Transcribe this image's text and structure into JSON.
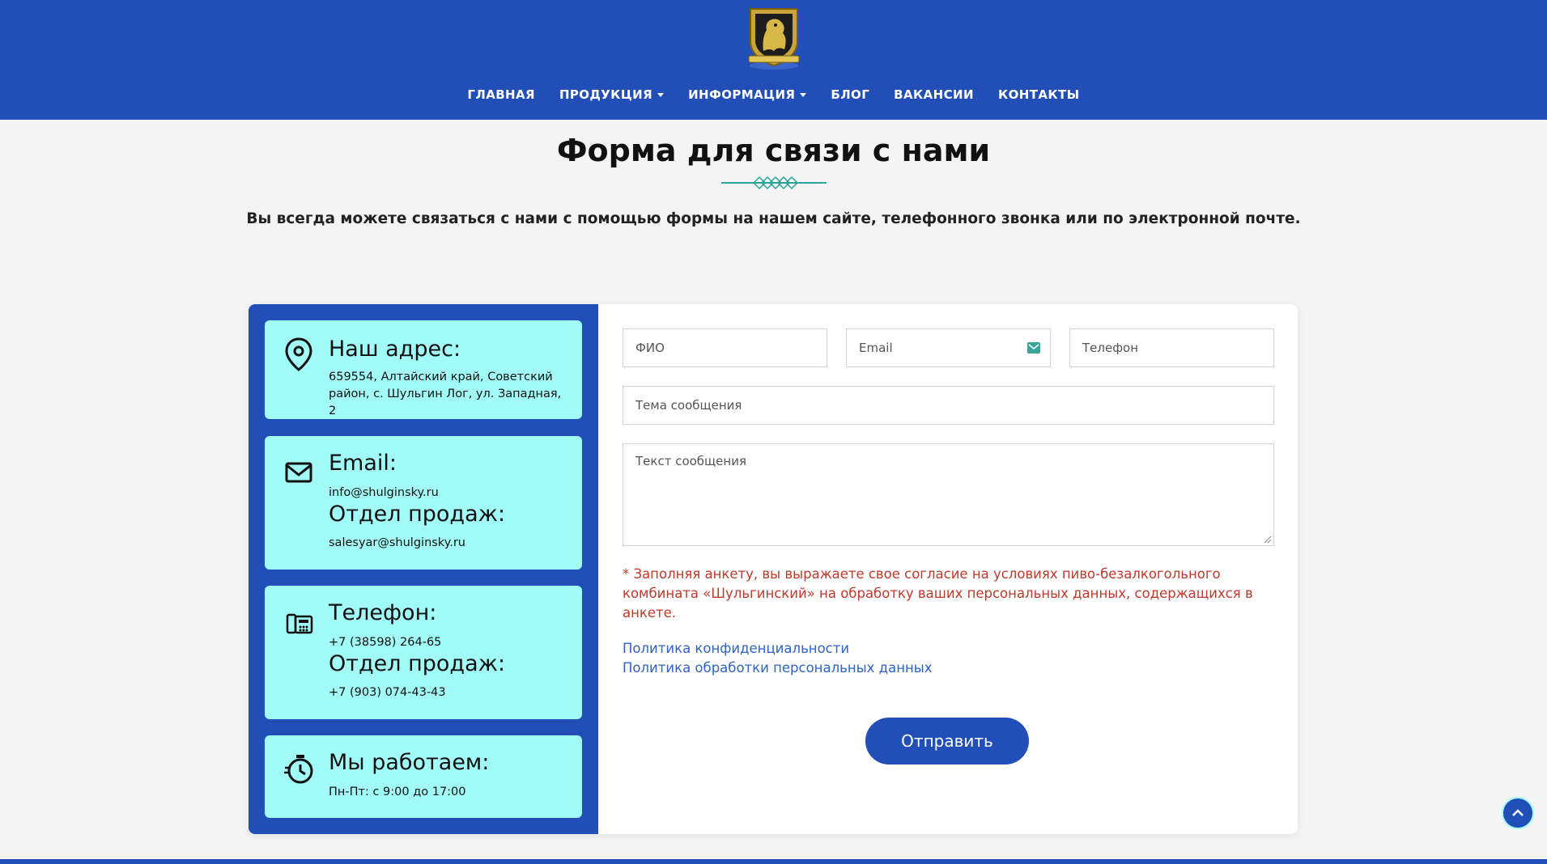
{
  "colors": {
    "brand_blue": "#224fb7",
    "card_cyan": "#a1fbf7",
    "consent_red": "#c0392b",
    "link_blue": "#2f62c7"
  },
  "header": {
    "logo_icon": "lion-crest-logo",
    "nav": [
      {
        "label": "ГЛАВНАЯ",
        "dropdown": false
      },
      {
        "label": "ПРОДУКЦИЯ",
        "dropdown": true
      },
      {
        "label": "ИНФОРМАЦИЯ",
        "dropdown": true
      },
      {
        "label": "БЛОГ",
        "dropdown": false
      },
      {
        "label": "ВАКАНСИИ",
        "dropdown": false
      },
      {
        "label": "КОНТАКТЫ",
        "dropdown": false
      }
    ]
  },
  "page": {
    "title": "Форма для связи с нами",
    "intro": "Вы всегда можете связаться с нами с помощью формы на нашем сайте, телефонного звонка или по электронной почте."
  },
  "contacts": {
    "address": {
      "icon": "map-pin-icon",
      "heading": "Наш адрес:",
      "text": "659554, Алтайский край, Советский район, с. Шульгин Лог, ул. Западная, 2"
    },
    "email": {
      "icon": "envelope-icon",
      "heading": "Email:",
      "value": "info@shulginsky.ru",
      "sales_heading": "Отдел продаж:",
      "sales_value": "salesyar@shulginsky.ru"
    },
    "phone": {
      "icon": "fax-phone-icon",
      "heading": "Телефон:",
      "value": "+7 (38598) 264-65",
      "sales_heading": "Отдел продаж:",
      "sales_value": "+7 (903) 074-43-43"
    },
    "hours": {
      "icon": "stopwatch-icon",
      "heading": "Мы работаем:",
      "value": "Пн-Пт: с 9:00 до 17:00"
    }
  },
  "form": {
    "name_placeholder": "ФИО",
    "email_placeholder": "Email",
    "email_icon": "email-badge-icon",
    "phone_placeholder": "Телефон",
    "subject_placeholder": "Тема сообщения",
    "message_placeholder": "Текст сообщения",
    "consent": "* Заполняя анкету, вы выражаете свое согласие на условиях пиво-безалкогольного комбината «Шульгинский» на обработку ваших персональных данных, содержащихся в анкете.",
    "privacy_link": "Политика конфиденциальности",
    "data_policy_link": "Политика обработки персональных данных",
    "submit_label": "Отправить"
  },
  "scroll_top_icon": "chevron-up-icon"
}
